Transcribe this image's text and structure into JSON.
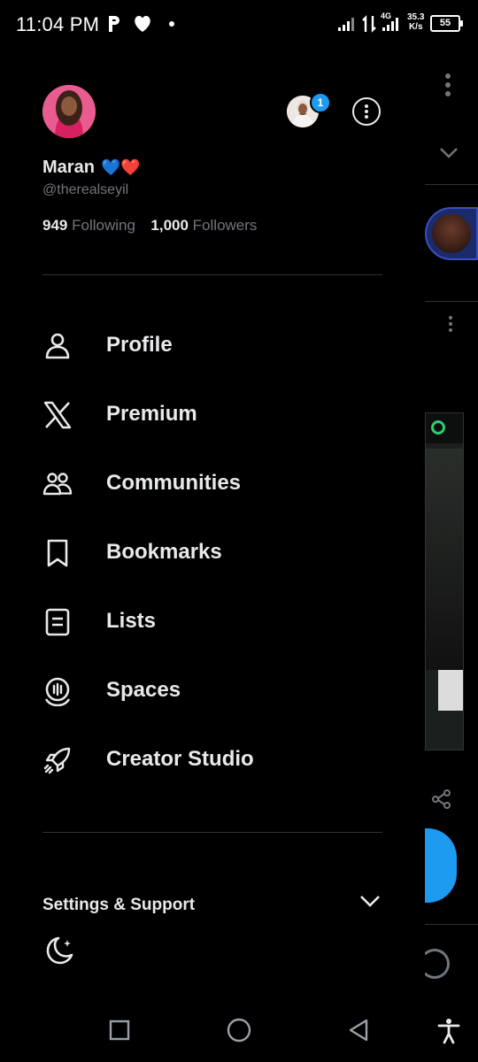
{
  "status_bar": {
    "time": "11:04 PM",
    "network_label": "4G",
    "speed_value": "35.3",
    "speed_unit": "K/s",
    "battery": "55"
  },
  "account": {
    "display_name": "Maran",
    "name_emoji": "💙❤️",
    "handle": "@therealseyil",
    "following_count": "949",
    "following_label": "Following",
    "followers_count": "1,000",
    "followers_label": "Followers",
    "switch_badge": "1"
  },
  "menu": [
    {
      "label": "Profile",
      "icon": "person-icon"
    },
    {
      "label": "Premium",
      "icon": "x-logo-icon"
    },
    {
      "label": "Communities",
      "icon": "communities-icon"
    },
    {
      "label": "Bookmarks",
      "icon": "bookmark-icon"
    },
    {
      "label": "Lists",
      "icon": "list-icon"
    },
    {
      "label": "Spaces",
      "icon": "spaces-icon"
    },
    {
      "label": "Creator Studio",
      "icon": "rocket-icon"
    }
  ],
  "settings_section": {
    "label": "Settings & Support"
  },
  "colors": {
    "background": "#000000",
    "text": "#e7e9ea",
    "muted": "#71767b",
    "accent": "#1d9bf0",
    "divider": "#2f3336"
  }
}
